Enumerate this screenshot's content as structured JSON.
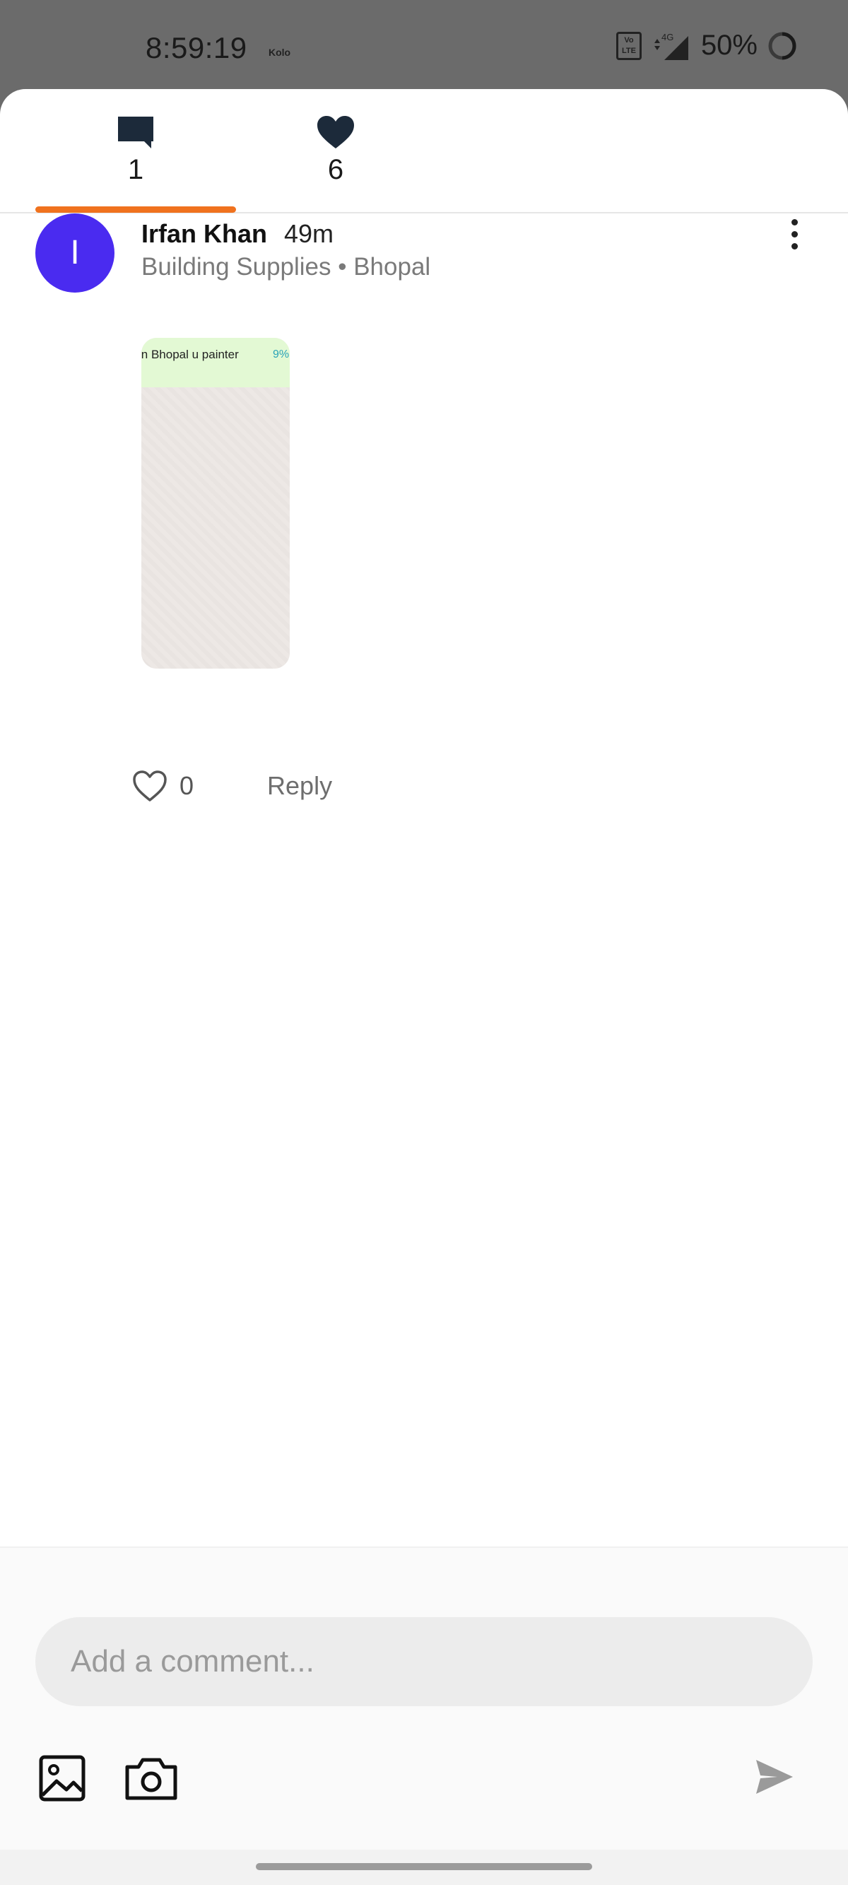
{
  "status_bar": {
    "time": "8:59:19",
    "carrier": "Kolo",
    "volte": "Vo LTE",
    "network": "4G",
    "battery": "50%"
  },
  "tabs": [
    {
      "name": "comments",
      "icon": "comment-icon",
      "count": "1",
      "active": true
    },
    {
      "name": "likes",
      "icon": "heart-icon",
      "count": "6",
      "active": false
    }
  ],
  "comment": {
    "avatar_initial": "I",
    "avatar_color": "#4a2bf0",
    "author": "Irfan Khan",
    "time": "49m",
    "subtitle": "Building Supplies • Bhopal",
    "attachment_text": "in Bhopal u painter",
    "attachment_number": "9%",
    "like_count": "0",
    "reply_label": "Reply"
  },
  "composer": {
    "placeholder": "Add a comment...",
    "gallery_icon": "image-icon",
    "camera_icon": "camera-icon",
    "send_icon": "send-icon"
  },
  "colors": {
    "accent": "#f0721e",
    "avatar": "#4a2bf0"
  }
}
